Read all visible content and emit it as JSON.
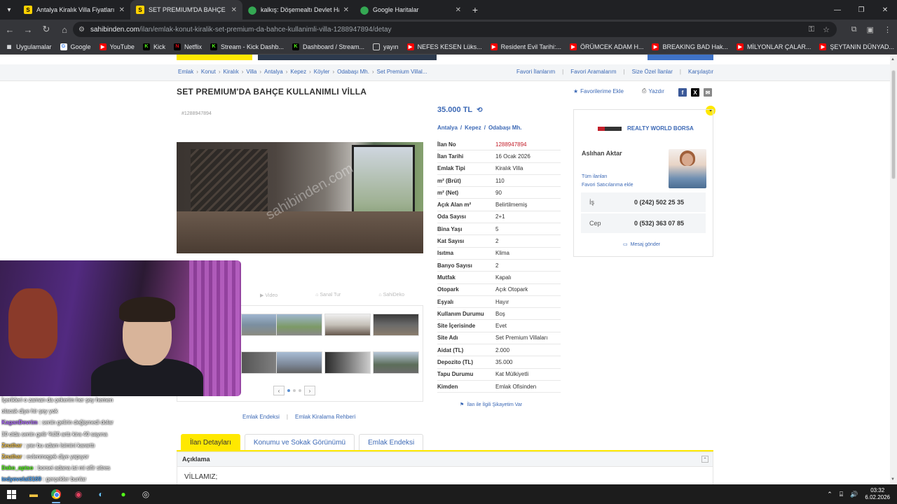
{
  "browser": {
    "tabs": [
      {
        "title": "Antalya Kiralık Villa Fiyatları sah",
        "icon": "sahibinden-favicon",
        "active": false
      },
      {
        "title": "SET PREMIUM'DA BAHÇE KULL",
        "icon": "sahibinden-favicon",
        "active": true
      },
      {
        "title": "kalkış: Döşemealtı Devlet Hasta",
        "icon": "maps-pin-icon",
        "active": false
      },
      {
        "title": "Google Haritalar",
        "icon": "maps-pin-icon",
        "active": false
      }
    ],
    "url_host": "sahibinden.com",
    "url_path": "/ilan/emlak-konut-kiralik-set-premium-da-bahce-kullanimli-villa-1288947894/detay",
    "bookmarks": [
      {
        "label": "Uygulamalar",
        "icon": "apps-grid-icon"
      },
      {
        "label": "Google",
        "icon": "google-icon"
      },
      {
        "label": "YouTube",
        "icon": "youtube-icon"
      },
      {
        "label": "Kick",
        "icon": "kick-icon"
      },
      {
        "label": "Netflix",
        "icon": "netflix-icon"
      },
      {
        "label": "Stream - Kick Dashb...",
        "icon": "kick-icon"
      },
      {
        "label": "Dashboard / Stream...",
        "icon": "kick-icon"
      },
      {
        "label": "yayın",
        "icon": "folder-icon"
      },
      {
        "label": "NEFES KESEN Lüks...",
        "icon": "youtube-icon"
      },
      {
        "label": "Resident Evil Tarihi:...",
        "icon": "youtube-icon"
      },
      {
        "label": "ÖRÜMCEK ADAM H...",
        "icon": "youtube-icon"
      },
      {
        "label": "BREAKING BAD Hak...",
        "icon": "youtube-icon"
      },
      {
        "label": "MİLYONLAR ÇALAR...",
        "icon": "youtube-icon"
      },
      {
        "label": "ŞEYTANIN DÜNYAD...",
        "icon": "youtube-icon"
      }
    ]
  },
  "breadcrumb": [
    "Emlak",
    "Konut",
    "Kiralık",
    "Villa",
    "Antalya",
    "Kepez",
    "Köyler",
    "Odabaşı Mh.",
    "Set Premium Villal..."
  ],
  "breadcrumb_right": [
    "Favori İlanlarım",
    "Favori Aramalarım",
    "Size Özel İlanlar",
    "Karşılaştır"
  ],
  "listing": {
    "title": "SET PREMIUM'DA BAHÇE KULLANIMLI VİLLA",
    "id_label": "#1288947894",
    "add_favorite": "Favorilerime Ekle",
    "print": "Yazdır",
    "price": "35.000 TL",
    "location": [
      "Antalya",
      "Kepez",
      "Odabaşı Mh."
    ],
    "photo_watermark": "sahibinden.com",
    "media_tabs": [
      "Video",
      "Sanal Tur",
      "SahiDeko"
    ],
    "details": [
      {
        "k": "İlan No",
        "v": "1288947894",
        "red": true
      },
      {
        "k": "İlan Tarihi",
        "v": "16 Ocak 2026"
      },
      {
        "k": "Emlak Tipi",
        "v": "Kiralık Villa"
      },
      {
        "k": "m² (Brüt)",
        "v": "110"
      },
      {
        "k": "m² (Net)",
        "v": "90"
      },
      {
        "k": "Açık Alan m²",
        "v": "Belirtilmemiş"
      },
      {
        "k": "Oda Sayısı",
        "v": "2+1"
      },
      {
        "k": "Bina Yaşı",
        "v": "5"
      },
      {
        "k": "Kat Sayısı",
        "v": "2"
      },
      {
        "k": "Isıtma",
        "v": "Klima"
      },
      {
        "k": "Banyo Sayısı",
        "v": "2"
      },
      {
        "k": "Mutfak",
        "v": "Kapalı"
      },
      {
        "k": "Otopark",
        "v": "Açık Otopark"
      },
      {
        "k": "Eşyalı",
        "v": "Hayır"
      },
      {
        "k": "Kullanım Durumu",
        "v": "Boş"
      },
      {
        "k": "Site İçerisinde",
        "v": "Evet"
      },
      {
        "k": "Site Adı",
        "v": "Set Premium Villaları"
      },
      {
        "k": "Aidat (TL)",
        "v": "2.000"
      },
      {
        "k": "Depozito (TL)",
        "v": "35.000"
      },
      {
        "k": "Tapu Durumu",
        "v": "Kat Mülkiyetli"
      },
      {
        "k": "Kimden",
        "v": "Emlak Ofisinden"
      }
    ],
    "complaint": "İlan ile İlgili Şikayetim Var"
  },
  "seller": {
    "agency": "REALTY WORLD BORSA",
    "agency_logo_text": "REALTY BORSA",
    "name": "Aslıhan Aktar",
    "all_listings": "Tüm ilanları",
    "add_favorite_seller": "Favori Satıcılarıma ekle",
    "phones": [
      {
        "label": "İş",
        "value": "0 (242) 502 25 35"
      },
      {
        "label": "Cep",
        "value": "0 (532) 363 07 85"
      }
    ],
    "message": "Mesaj gönder"
  },
  "footer_links": [
    "Emlak Endeksi",
    "Emlak Kiralama Rehberi"
  ],
  "detail_tabs": [
    {
      "label": "İlan Detayları",
      "active": true
    },
    {
      "label": "Konumu ve Sokak Görünümü",
      "active": false
    },
    {
      "label": "Emlak Endeksi",
      "active": false
    }
  ],
  "description": {
    "heading": "Açıklama",
    "first_line": "VİLLAMIZ;"
  },
  "chat": [
    {
      "user": "",
      "text": "İçerikleri o zaman da çekerim her şey hemen"
    },
    {
      "user": "",
      "text": "olacak diye hir şey yok"
    },
    {
      "user": "KaganDevrim",
      "text": ": senin gelirin değişmedi dolar"
    },
    {
      "user": "",
      "text": "30 olda senin gelir %30 arttı kira 40 sayına"
    },
    {
      "user": "Zeuthar",
      "text": ": yav bu adam lsimini kararttı"
    },
    {
      "user": "Zeuthar",
      "text": ": evlenmegek diye yapıyor"
    },
    {
      "user": "Dako_aptso",
      "text": ": borsei adana ist mi sifir sitres"
    },
    {
      "user": "tedyevolal3169",
      "text": ": gerçekler bunlar"
    }
  ],
  "taskbar": {
    "time": "03:32",
    "date": "6.02.2026"
  }
}
